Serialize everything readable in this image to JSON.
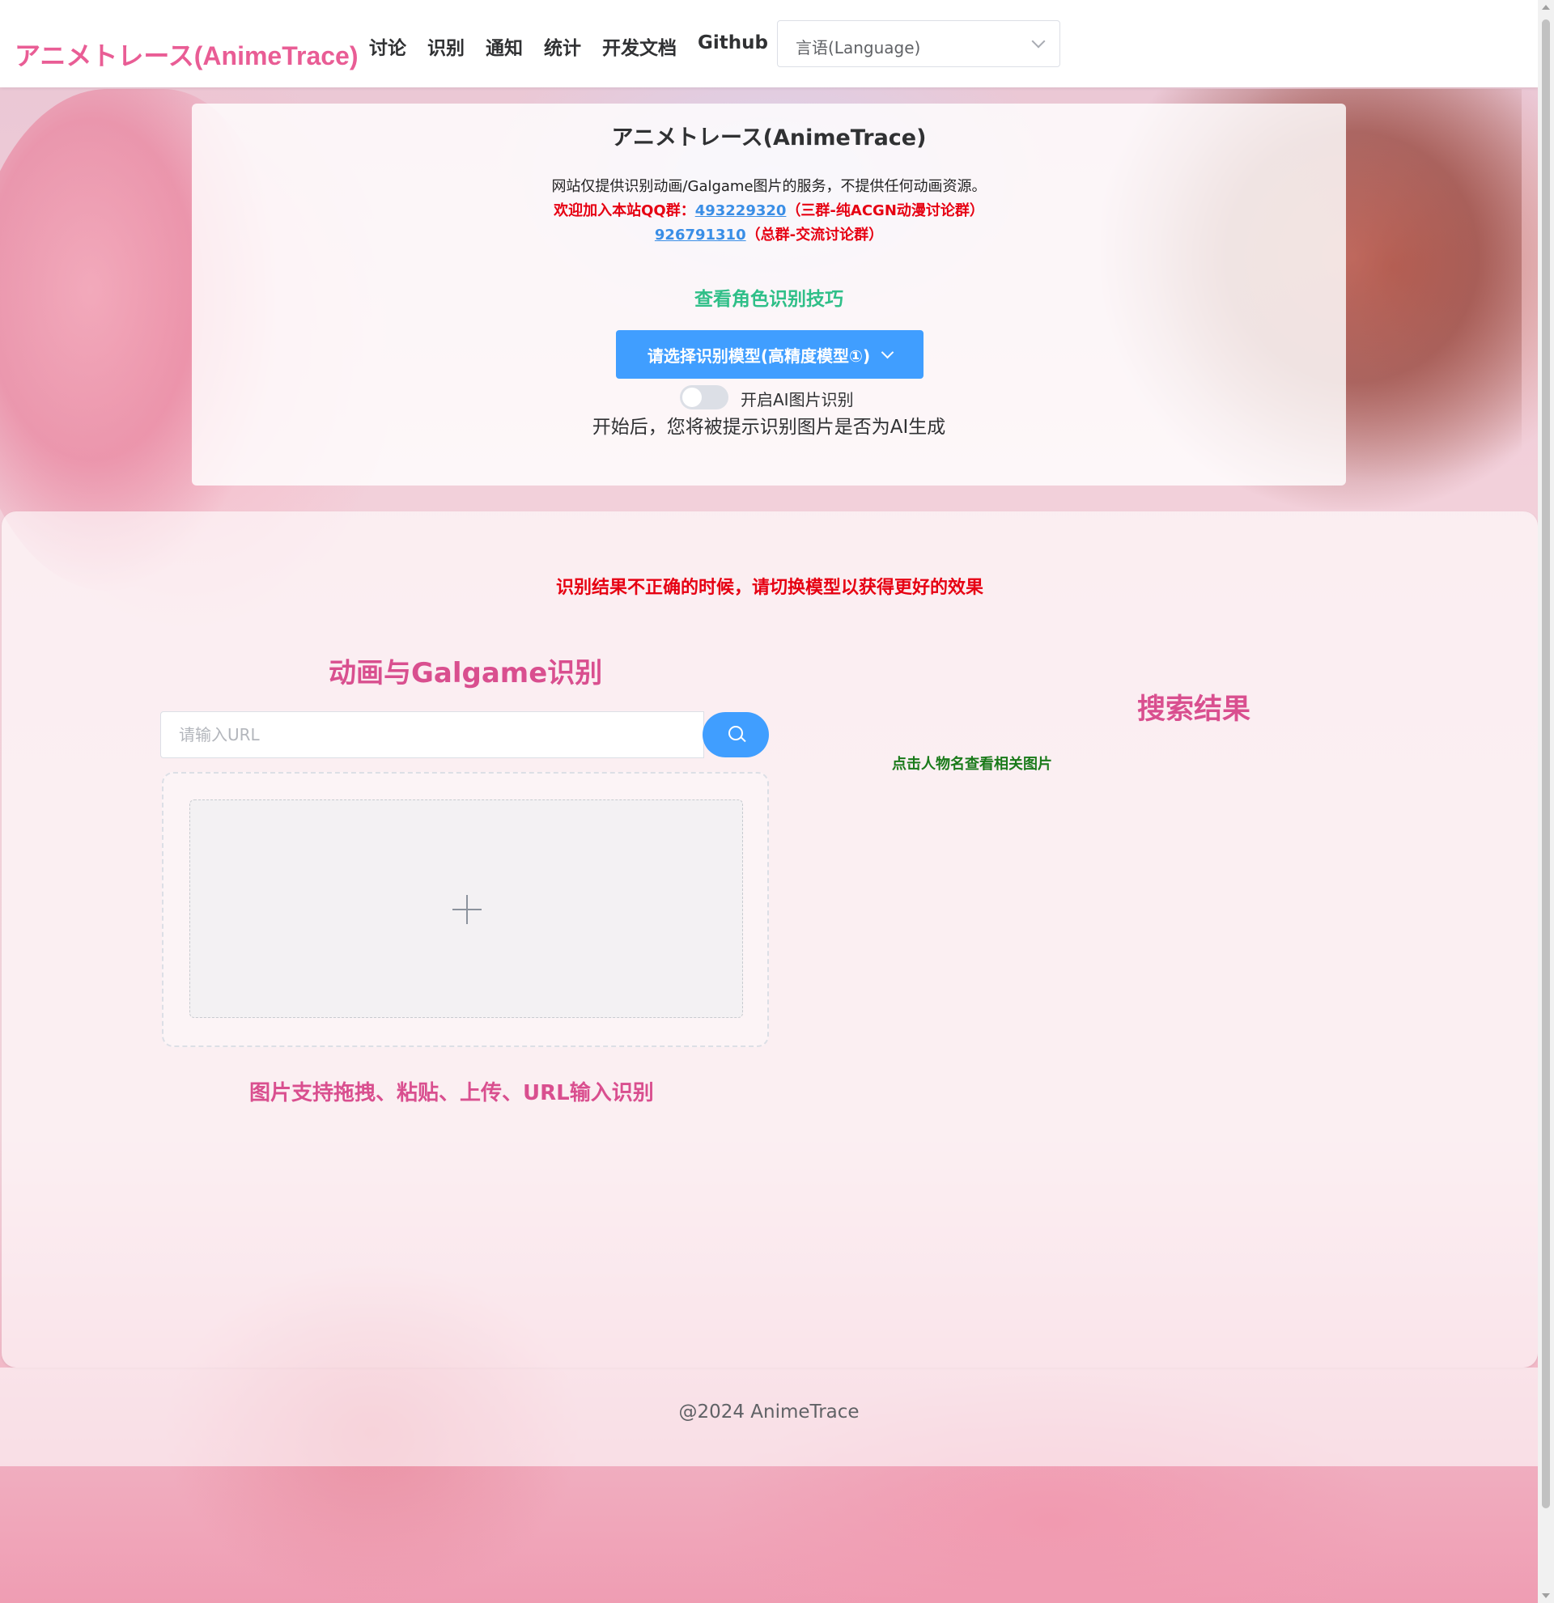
{
  "header": {
    "logo": "アニメトレース(AnimeTrace)",
    "nav": [
      "讨论",
      "识别",
      "通知",
      "统计",
      "开发文档",
      "Github"
    ],
    "language_select": "言语(Language)"
  },
  "info": {
    "title": "アニメトレース(AnimeTrace)",
    "disclaimer": "网站仅提供识别动画/Galgame图片的服务，不提供任何动画资源。",
    "qq_prefix": "欢迎加入本站QQ群：",
    "qq_group_1": "493229320",
    "qq_group_1_desc": "（三群-纯ACGN动漫讨论群）",
    "qq_group_2": "926791310",
    "qq_group_2_desc": "（总群-交流讨论群）",
    "tips_link": "查看角色识别技巧",
    "model_button": "请选择识别模型(高精度模型①)",
    "ai_toggle_label": "开启AI图片识别",
    "ai_toggle_on": false,
    "ai_note": "开始后，您将被提示识别图片是否为AI生成"
  },
  "main": {
    "warning": "识别结果不正确的时候，请切换模型以获得更好的效果",
    "section_title": "动画与Galgame识别",
    "url_placeholder": "请输入URL",
    "upload_hint": "图片支持拖拽、粘贴、上传、URL输入识别",
    "results_title": "搜索结果",
    "results_hint": "点击人物名查看相关图片"
  },
  "footer": {
    "copyright": "@2024 AnimeTrace"
  },
  "colors": {
    "brand_pink": "#e95d95",
    "primary_blue": "#409eff",
    "warning_red": "#e60012",
    "tips_green": "#2fbf88"
  }
}
